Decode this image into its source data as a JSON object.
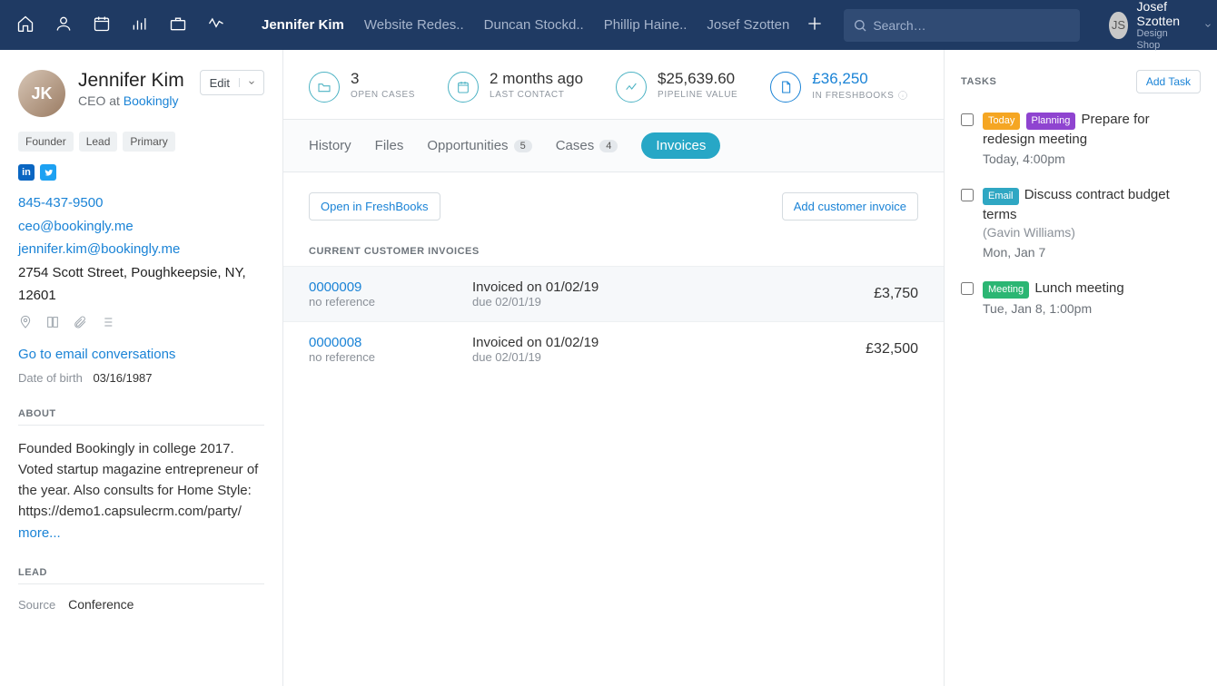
{
  "nav": {
    "tabs": [
      "Jennifer Kim",
      "Website Redes..",
      "Duncan Stockd..",
      "Phillip Haine..",
      "Josef Szotten"
    ],
    "active_index": 0,
    "search_placeholder": "Search…",
    "user_name": "Josef Szotten",
    "user_org": "Design Shop"
  },
  "contact": {
    "name": "Jennifer Kim",
    "role_prefix": "CEO at ",
    "company": "Bookingly",
    "edit_label": "Edit",
    "tags": [
      "Founder",
      "Lead",
      "Primary"
    ],
    "phone": "845-437-9500",
    "email1": "ceo@bookingly.me",
    "email2": "jennifer.kim@bookingly.me",
    "address": "2754 Scott Street, Poughkeepsie, NY, 12601",
    "go_email": "Go to email conversations",
    "dob_label": "Date of birth",
    "dob": "03/16/1987",
    "about_head": "ABOUT",
    "about": "Founded Bookingly in college 2017. Voted startup magazine entrepreneur of the year. Also consults for Home Style: https://demo1.capsulecrm.com/party/ ",
    "more": "more...",
    "lead_head": "LEAD",
    "lead_source_label": "Source",
    "lead_source": "Conference"
  },
  "stats": [
    {
      "value": "3",
      "label": "OPEN CASES"
    },
    {
      "value": "2 months ago",
      "label": "LAST CONTACT"
    },
    {
      "value": "$25,639.60",
      "label": "PIPELINE VALUE"
    },
    {
      "value": "£36,250",
      "label": "IN FRESHBOOKS",
      "blue": true,
      "info": true
    }
  ],
  "tabs": {
    "items": [
      {
        "label": "History"
      },
      {
        "label": "Files"
      },
      {
        "label": "Opportunities",
        "badge": "5"
      },
      {
        "label": "Cases",
        "badge": "4"
      },
      {
        "label": "Invoices",
        "active": true
      }
    ]
  },
  "invoices": {
    "open_btn": "Open in FreshBooks",
    "add_btn": "Add customer invoice",
    "section_title": "CURRENT CUSTOMER INVOICES",
    "rows": [
      {
        "num": "0000009",
        "ref": "no reference",
        "invoiced": "Invoiced on 01/02/19",
        "due": "due 02/01/19",
        "amount": "£3,750",
        "hover": true
      },
      {
        "num": "0000008",
        "ref": "no reference",
        "invoiced": "Invoiced on 01/02/19",
        "due": "due 02/01/19",
        "amount": "£32,500"
      }
    ]
  },
  "tasks": {
    "head": "TASKS",
    "add_btn": "Add Task",
    "items": [
      {
        "pills": [
          {
            "cls": "today",
            "text": "Today"
          },
          {
            "cls": "planning",
            "text": "Planning"
          }
        ],
        "title": "Prepare for redesign meeting",
        "sub": "Today, 4:00pm"
      },
      {
        "pills": [
          {
            "cls": "email",
            "text": "Email"
          }
        ],
        "title": "Discuss contract budget terms",
        "extra": "(Gavin Williams)",
        "sub": "Mon, Jan 7"
      },
      {
        "pills": [
          {
            "cls": "meeting",
            "text": "Meeting"
          }
        ],
        "title": "Lunch meeting",
        "sub": "Tue, Jan 8, 1:00pm"
      }
    ]
  }
}
